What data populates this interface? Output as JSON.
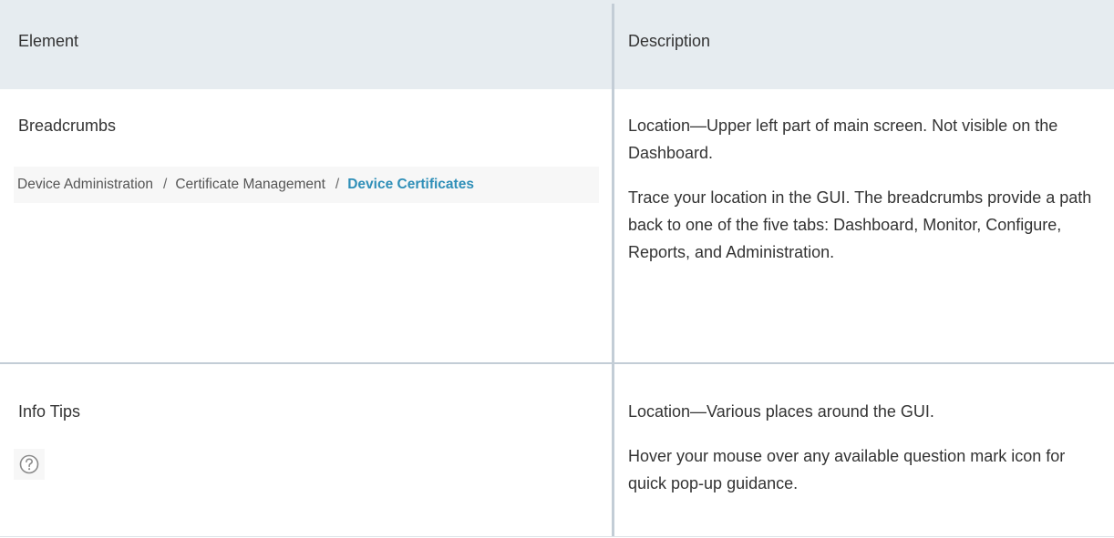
{
  "table": {
    "headers": {
      "element": "Element",
      "description": "Description"
    },
    "rows": [
      {
        "element": "Breadcrumbs",
        "example": {
          "breadcrumb_items": [
            "Device Administration",
            "Certificate Management"
          ],
          "separator": "/",
          "current": "Device Certificates",
          "current_color": "#2f8fb8"
        },
        "description": [
          "Location—Upper left part of main screen. Not visible on the Dashboard.",
          "Trace your location in the GUI. The breadcrumbs provide a path back to one of the five tabs: Dashboard, Monitor, Configure, Reports, and Administration."
        ]
      },
      {
        "element": "Info Tips",
        "example": {
          "icon": "question-mark-circle-icon"
        },
        "description": [
          "Location—Various places around the GUI.",
          "Hover your mouse over any available question mark icon for quick pop-up guidance."
        ]
      }
    ]
  },
  "colors": {
    "header_background": "#e6ecf0",
    "divider": "#c3cdd6",
    "text": "#333333"
  }
}
